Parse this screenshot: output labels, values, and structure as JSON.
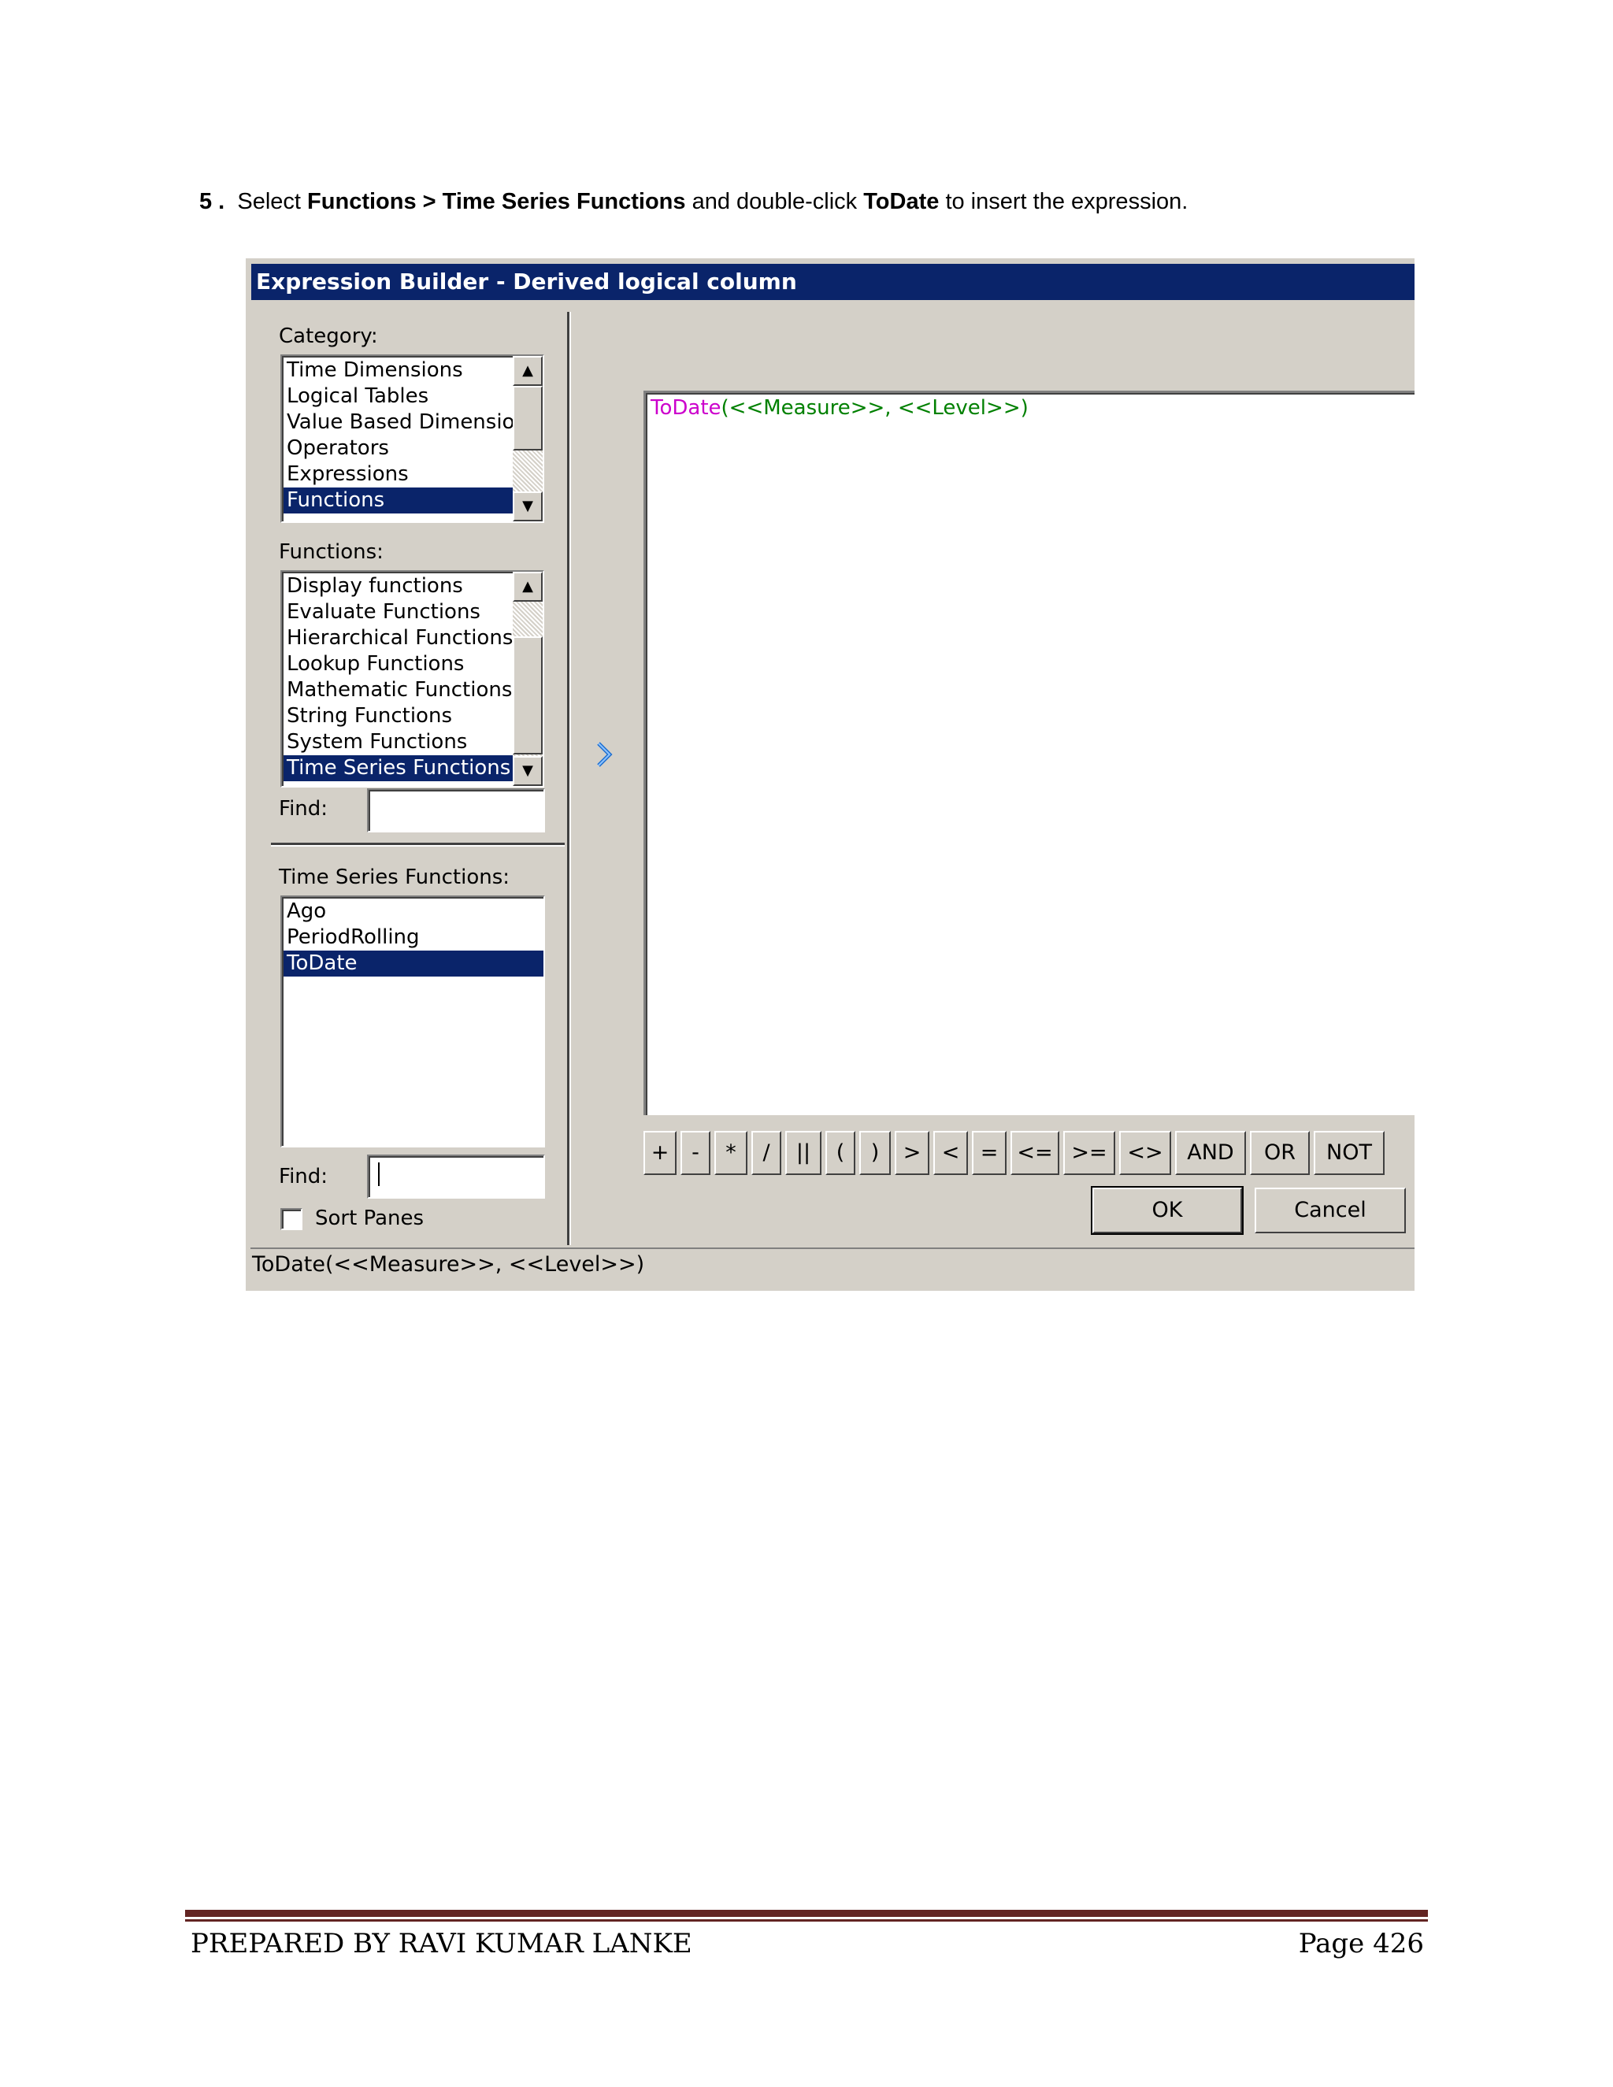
{
  "instruction": {
    "number": "5 .",
    "select": "Select",
    "path": "Functions > Time Series Functions",
    "and": "and double-click",
    "target": "ToDate",
    "rest": "to insert the expression."
  },
  "dialog": {
    "title": "Expression Builder - Derived logical column",
    "category_label": "Category:",
    "categories": [
      "Time Dimensions",
      "Logical Tables",
      "Value Based Dimensions",
      "Operators",
      "Expressions",
      "Functions"
    ],
    "category_selected": "Functions",
    "functions_label": "Functions:",
    "functions": [
      "Display functions",
      "Evaluate Functions",
      "Hierarchical Functions",
      "Lookup Functions",
      "Mathematic Functions",
      "String Functions",
      "System Functions",
      "Time Series Functions"
    ],
    "functions_selected": "Time Series Functions",
    "find_label": "Find:",
    "ts_label": "Time Series Functions:",
    "ts_functions": [
      "Ago",
      "PeriodRolling",
      "ToDate"
    ],
    "ts_selected": "ToDate",
    "find2_label": "Find:",
    "sort_panes_label": "Sort Panes",
    "expression_fn": "ToDate",
    "expression_args": "(<<Measure>>, <<Level>>)",
    "operators": [
      "+",
      "-",
      "*",
      "/",
      "||",
      "(",
      ")",
      ">",
      "<",
      "=",
      "<=",
      ">=",
      "<>",
      "AND",
      "OR",
      "NOT"
    ],
    "ok_label": "OK",
    "cancel_label": "Cancel",
    "status_text": "ToDate(<<Measure>>, <<Level>>)",
    "colors": {
      "title_bg": "#0a246a",
      "function_name": "#cc00cc",
      "args": "#008000"
    }
  },
  "footer": {
    "left": "PREPARED BY RAVI KUMAR LANKE",
    "right": "Page 426"
  }
}
